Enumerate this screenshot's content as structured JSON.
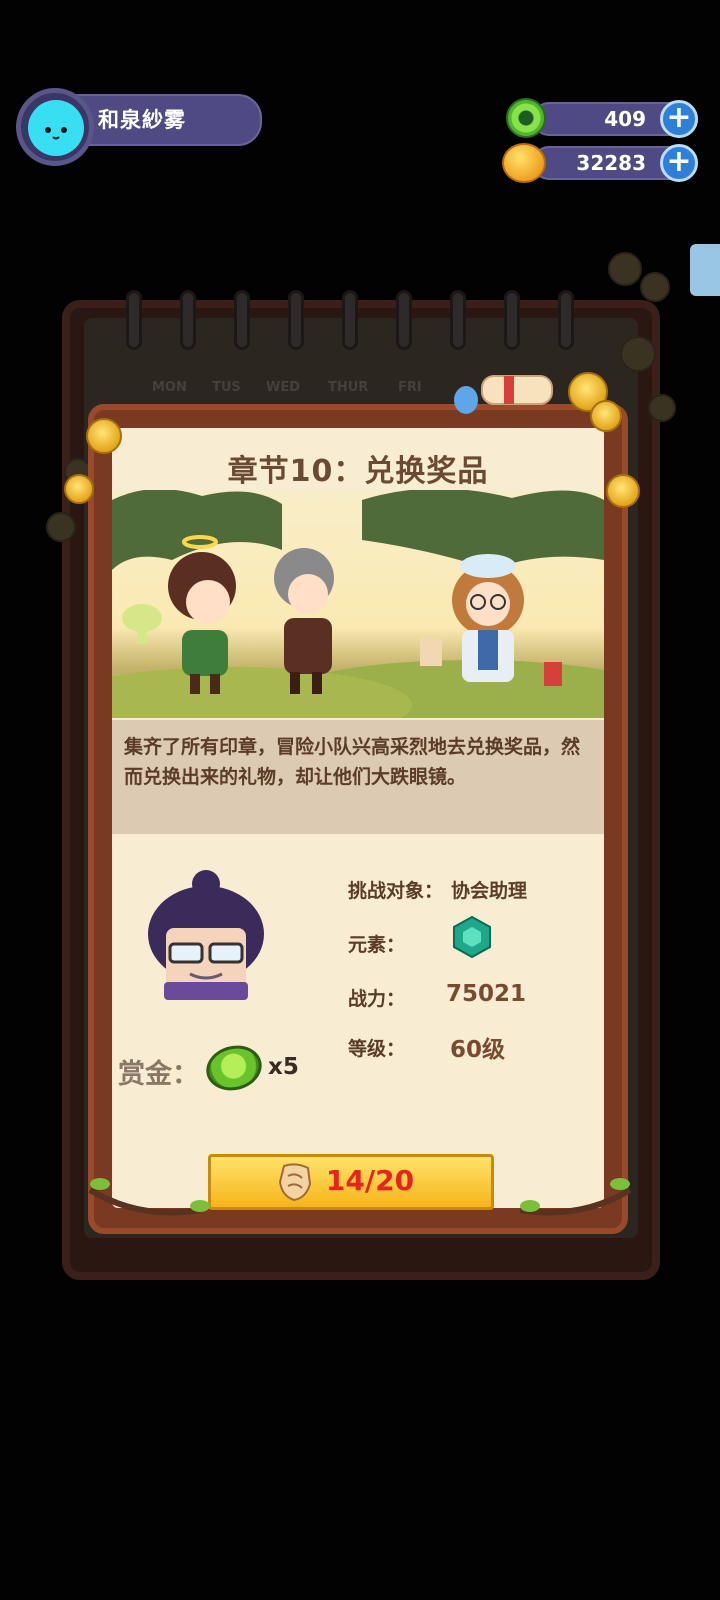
{
  "player": {
    "name": "和泉紗雾",
    "avatar_icon": "cat-face-icon"
  },
  "currencies": [
    {
      "icon": "green-gem-icon",
      "value": "409"
    },
    {
      "icon": "planet-coin-icon",
      "value": "32283"
    }
  ],
  "plus_glyph": "+",
  "background_calendar": {
    "weekdays": [
      "MON",
      "TUS",
      "WED",
      "THUR",
      "FRI"
    ]
  },
  "chapter": {
    "title": "章节10：兑换奖品",
    "description": "集齐了所有印章，冒险小队兴高采烈地去兑换奖品，然而兑换出来的礼物，却让他们大跌眼镜。"
  },
  "challenge": {
    "target_label": "挑战对象：",
    "target_value": "协会助理",
    "element_label": "元素：",
    "element_icon": "hexagon-gem-icon",
    "power_label": "战力：",
    "power_value": "75021",
    "level_label": "等级：",
    "level_value": "60级"
  },
  "bounty": {
    "label": "赏金：",
    "reward_icon": "green-token-icon",
    "quantity": "x5"
  },
  "action": {
    "stamp_icon": "stamp-fragment-icon",
    "progress": "14/20"
  },
  "colors": {
    "hud_bar": "#4f4a83",
    "accent_button": "#f6b41a",
    "progress_text": "#e8231e",
    "card_paper": "#f8ecd2"
  }
}
